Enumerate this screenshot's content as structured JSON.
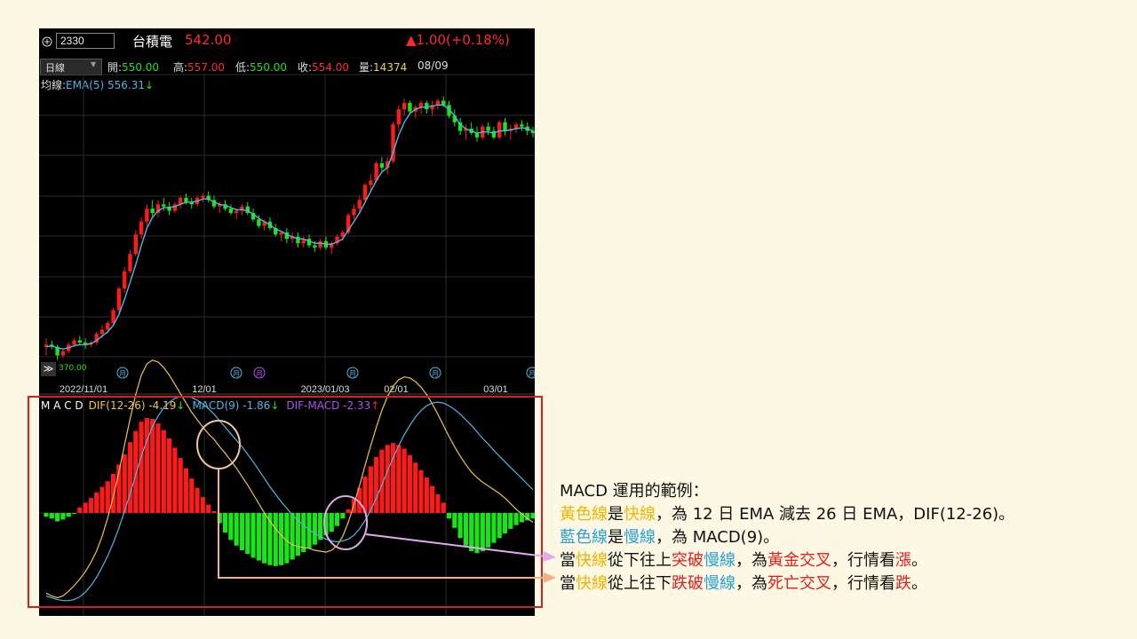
{
  "header": {
    "code": "2330",
    "name": "台積電",
    "price": "542.00",
    "change": "▲1.00(+0.18%)"
  },
  "ohlc": {
    "period": "日線",
    "open_label": "開:",
    "open": "550.00",
    "high_label": "高:",
    "high": "557.00",
    "low_label": "低:",
    "low": "550.00",
    "close_label": "收:",
    "close": "554.00",
    "vol_label": "量:",
    "vol": "14374",
    "date": "08/09"
  },
  "ma": {
    "label": "均線:",
    "value": "EMA(5) 556.31",
    "arrow": "↓"
  },
  "price_chart": {
    "low_marker": "370.00",
    "month_icon": "月",
    "xlabels": [
      "2022/11/01",
      "12/01",
      "2023/01/03",
      "02/01",
      "03/01"
    ]
  },
  "macd_header": {
    "title": "M A C D",
    "dif": "DIF(12-26)  -4.19",
    "dif_arrow": "↓",
    "macd": "MACD(9)  -1.86",
    "macd_arrow": "↓",
    "osc": "DIF-MACD  -2.33",
    "osc_arrow": "↑"
  },
  "colors": {
    "up": "#ff1a1a",
    "down": "#19e619",
    "dif": "#f0c24a",
    "macd": "#4fb6e6",
    "osc": "#b04ef0",
    "accent_red": "#e02020",
    "box_red": "#d81e1e"
  },
  "chart_data": {
    "type": "bar",
    "categories": [],
    "price_candles": [
      [
        370,
        374,
        366,
        371
      ],
      [
        371,
        373,
        369,
        370
      ],
      [
        370,
        371,
        364,
        366
      ],
      [
        366,
        369,
        365,
        368
      ],
      [
        368,
        372,
        367,
        371
      ],
      [
        371,
        374,
        370,
        373
      ],
      [
        373,
        375,
        371,
        372
      ],
      [
        372,
        374,
        369,
        371
      ],
      [
        371,
        373,
        370,
        372
      ],
      [
        372,
        377,
        371,
        376
      ],
      [
        376,
        380,
        374,
        378
      ],
      [
        378,
        382,
        376,
        381
      ],
      [
        381,
        388,
        380,
        387
      ],
      [
        387,
        398,
        386,
        397
      ],
      [
        397,
        407,
        395,
        405
      ],
      [
        405,
        415,
        404,
        413
      ],
      [
        413,
        424,
        412,
        422
      ],
      [
        422,
        430,
        420,
        428
      ],
      [
        428,
        436,
        426,
        434
      ],
      [
        434,
        438,
        430,
        432
      ],
      [
        432,
        438,
        430,
        436
      ],
      [
        436,
        439,
        433,
        435
      ],
      [
        435,
        437,
        431,
        433
      ],
      [
        433,
        437,
        432,
        436
      ],
      [
        436,
        440,
        434,
        439
      ],
      [
        439,
        441,
        436,
        437
      ],
      [
        437,
        439,
        434,
        436
      ],
      [
        436,
        440,
        435,
        439
      ],
      [
        439,
        441,
        437,
        440
      ],
      [
        440,
        442,
        437,
        438
      ],
      [
        438,
        440,
        434,
        435
      ],
      [
        435,
        437,
        432,
        436
      ],
      [
        436,
        438,
        433,
        434
      ],
      [
        434,
        436,
        431,
        432
      ],
      [
        432,
        434,
        429,
        433
      ],
      [
        433,
        436,
        431,
        435
      ],
      [
        435,
        437,
        431,
        432
      ],
      [
        432,
        434,
        428,
        429
      ],
      [
        429,
        431,
        425,
        426
      ],
      [
        426,
        429,
        424,
        428
      ],
      [
        428,
        430,
        424,
        425
      ],
      [
        425,
        427,
        421,
        422
      ],
      [
        422,
        424,
        419,
        423
      ],
      [
        423,
        425,
        418,
        420
      ],
      [
        420,
        423,
        418,
        421
      ],
      [
        421,
        423,
        416,
        418
      ],
      [
        418,
        421,
        416,
        420
      ],
      [
        420,
        422,
        416,
        417
      ],
      [
        417,
        419,
        414,
        416
      ],
      [
        416,
        420,
        415,
        419
      ],
      [
        419,
        421,
        415,
        416
      ],
      [
        416,
        419,
        413,
        418
      ],
      [
        418,
        422,
        417,
        421
      ],
      [
        421,
        424,
        419,
        423
      ],
      [
        423,
        432,
        422,
        431
      ],
      [
        431,
        436,
        429,
        434
      ],
      [
        434,
        440,
        432,
        438
      ],
      [
        438,
        446,
        437,
        445
      ],
      [
        445,
        450,
        442,
        447
      ],
      [
        447,
        456,
        446,
        455
      ],
      [
        455,
        458,
        451,
        453
      ],
      [
        453,
        458,
        450,
        456
      ],
      [
        456,
        474,
        455,
        473
      ],
      [
        473,
        482,
        470,
        480
      ],
      [
        480,
        485,
        477,
        483
      ],
      [
        483,
        484,
        478,
        479
      ],
      [
        479,
        482,
        476,
        481
      ],
      [
        481,
        484,
        478,
        483
      ],
      [
        483,
        484,
        478,
        480
      ],
      [
        480,
        484,
        477,
        482
      ],
      [
        482,
        485,
        480,
        484
      ],
      [
        484,
        486,
        481,
        482
      ],
      [
        482,
        484,
        476,
        477
      ],
      [
        477,
        480,
        472,
        474
      ],
      [
        474,
        476,
        468,
        470
      ],
      [
        470,
        473,
        466,
        471
      ],
      [
        471,
        474,
        468,
        469
      ],
      [
        469,
        472,
        465,
        467
      ],
      [
        467,
        473,
        466,
        472
      ],
      [
        472,
        474,
        468,
        470
      ],
      [
        470,
        472,
        466,
        467
      ],
      [
        467,
        475,
        466,
        474
      ],
      [
        474,
        476,
        468,
        470
      ],
      [
        470,
        473,
        466,
        471
      ],
      [
        471,
        474,
        469,
        473
      ],
      [
        473,
        475,
        470,
        472
      ],
      [
        472,
        474,
        468,
        470
      ],
      [
        470,
        472,
        467,
        469
      ]
    ],
    "ema5": [
      370,
      370.5,
      369.5,
      369,
      369.5,
      370.5,
      371,
      371,
      371.5,
      373,
      375,
      377,
      380,
      385,
      392,
      400,
      408,
      417,
      425,
      430,
      433,
      434.5,
      434.5,
      435,
      436,
      437,
      437,
      437.5,
      438.5,
      438.5,
      437,
      436,
      435.5,
      434.5,
      433.5,
      433.5,
      433,
      431.5,
      429.5,
      428,
      426.5,
      424.5,
      423.5,
      422,
      421,
      420,
      420,
      419,
      418,
      418,
      417.5,
      417.5,
      418.5,
      420,
      424,
      428,
      432,
      437,
      442,
      447,
      451,
      453,
      460,
      468,
      474,
      478,
      480,
      481,
      481,
      481.5,
      482,
      482,
      480,
      477,
      473,
      471,
      470,
      469,
      469.5,
      469.5,
      469,
      470,
      470,
      470.5,
      471,
      471.5,
      471,
      470
    ],
    "histogram": [
      -0.4,
      -0.6,
      -0.9,
      -0.7,
      -0.4,
      -0.1,
      0.6,
      1.1,
      1.6,
      2.2,
      2.8,
      3.4,
      4.2,
      5.2,
      6.3,
      7.6,
      8.8,
      9.8,
      10.2,
      10.1,
      9.6,
      8.9,
      8.0,
      7.0,
      5.9,
      4.8,
      3.7,
      2.7,
      1.7,
      0.9,
      0.2,
      -1.1,
      -2.1,
      -2.9,
      -3.5,
      -4.0,
      -4.4,
      -4.8,
      -5.1,
      -5.4,
      -5.6,
      -5.7,
      -5.6,
      -5.4,
      -5.0,
      -4.6,
      -4.2,
      -3.8,
      -3.4,
      -2.9,
      -2.4,
      -2.0,
      -1.4,
      -0.6,
      0.4,
      1.5,
      2.7,
      3.9,
      5.0,
      6.0,
      6.8,
      7.3,
      7.5,
      7.3,
      6.9,
      6.2,
      5.4,
      4.6,
      3.8,
      2.9,
      2.0,
      1.1,
      -0.6,
      -1.6,
      -2.7,
      -3.5,
      -4.1,
      -4.3,
      -4.1,
      -3.7,
      -3.2,
      -2.7,
      -2.2,
      -1.7,
      -1.3,
      -1.0,
      -0.8,
      -0.6
    ],
    "dif": [
      -8.6,
      -8.9,
      -9.1,
      -8.9,
      -8.4,
      -7.8,
      -7.1,
      -6.3,
      -5.3,
      -4.1,
      -2.5,
      -0.5,
      1.8,
      4.4,
      7.3,
      10.1,
      12.7,
      14.8,
      16.0,
      16.4,
      16.2,
      15.6,
      14.8,
      13.8,
      12.8,
      11.8,
      10.8,
      10.0,
      9.2,
      8.5,
      7.9,
      7.1,
      6.4,
      5.6,
      4.8,
      3.9,
      3.0,
      2.0,
      1.0,
      0.0,
      -0.9,
      -1.7,
      -2.4,
      -3.0,
      -3.4,
      -3.6,
      -3.7,
      -3.8,
      -4.0,
      -4.1,
      -4.2,
      -4.0,
      -3.5,
      -2.5,
      -1.0,
      0.9,
      2.9,
      5.1,
      7.2,
      9.2,
      11.0,
      12.5,
      13.6,
      14.3,
      14.6,
      14.5,
      14.1,
      13.5,
      12.7,
      11.7,
      10.6,
      9.4,
      8.2,
      7.1,
      6.1,
      5.2,
      4.4,
      3.8,
      3.3,
      2.9,
      2.5,
      2.1,
      1.6,
      1.0,
      0.4,
      -0.1,
      -0.6,
      -1.0
    ],
    "macd9": [
      -8.9,
      -9.1,
      -9.3,
      -9.4,
      -9.4,
      -9.3,
      -9.0,
      -8.5,
      -7.8,
      -6.9,
      -5.8,
      -4.6,
      -3.2,
      -1.6,
      0.2,
      2.1,
      4.1,
      6.1,
      7.8,
      9.3,
      10.4,
      11.3,
      11.9,
      12.3,
      12.5,
      12.5,
      12.4,
      12.1,
      11.7,
      11.2,
      10.6,
      9.9,
      9.2,
      8.5,
      7.8,
      7.1,
      6.3,
      5.5,
      4.6,
      3.7,
      2.8,
      2.0,
      1.2,
      0.5,
      -0.2,
      -0.8,
      -1.3,
      -1.8,
      -2.2,
      -2.5,
      -2.8,
      -3.0,
      -3.1,
      -3.0,
      -2.8,
      -2.4,
      -1.7,
      -0.8,
      0.3,
      1.6,
      3.0,
      4.5,
      5.9,
      7.2,
      8.4,
      9.4,
      10.3,
      11.0,
      11.5,
      11.8,
      11.9,
      11.8,
      11.5,
      11.1,
      10.6,
      10.0,
      9.4,
      8.7,
      8.0,
      7.4,
      6.7,
      6.1,
      5.5,
      4.9,
      4.3,
      3.7,
      3.1,
      2.5
    ]
  },
  "notes": {
    "title": "MACD 運用的範例：",
    "line1": {
      "a": "黃色線",
      "b": "是",
      "c": "快線",
      "d": "，為 12 日 EMA 減去 26 日 EMA，DIF(12-26)。"
    },
    "line2": {
      "a": "藍色線",
      "b": "是",
      "c": "慢線",
      "d": "，為 MACD(9)。"
    },
    "line3": {
      "a": "當",
      "b": "快線",
      "c": "從下往上",
      "d": "突破",
      "e": "慢線",
      "f": "，為",
      "g": "黃金交叉",
      "h": "，行情看",
      "i": "漲",
      "j": "。"
    },
    "line4": {
      "a": "當",
      "b": "快線",
      "c": "從上往下",
      "d": "跌破",
      "e": "慢線",
      "f": "，為",
      "g": "死亡交叉",
      "h": "，行情看",
      "i": "跌",
      "j": "。"
    }
  }
}
